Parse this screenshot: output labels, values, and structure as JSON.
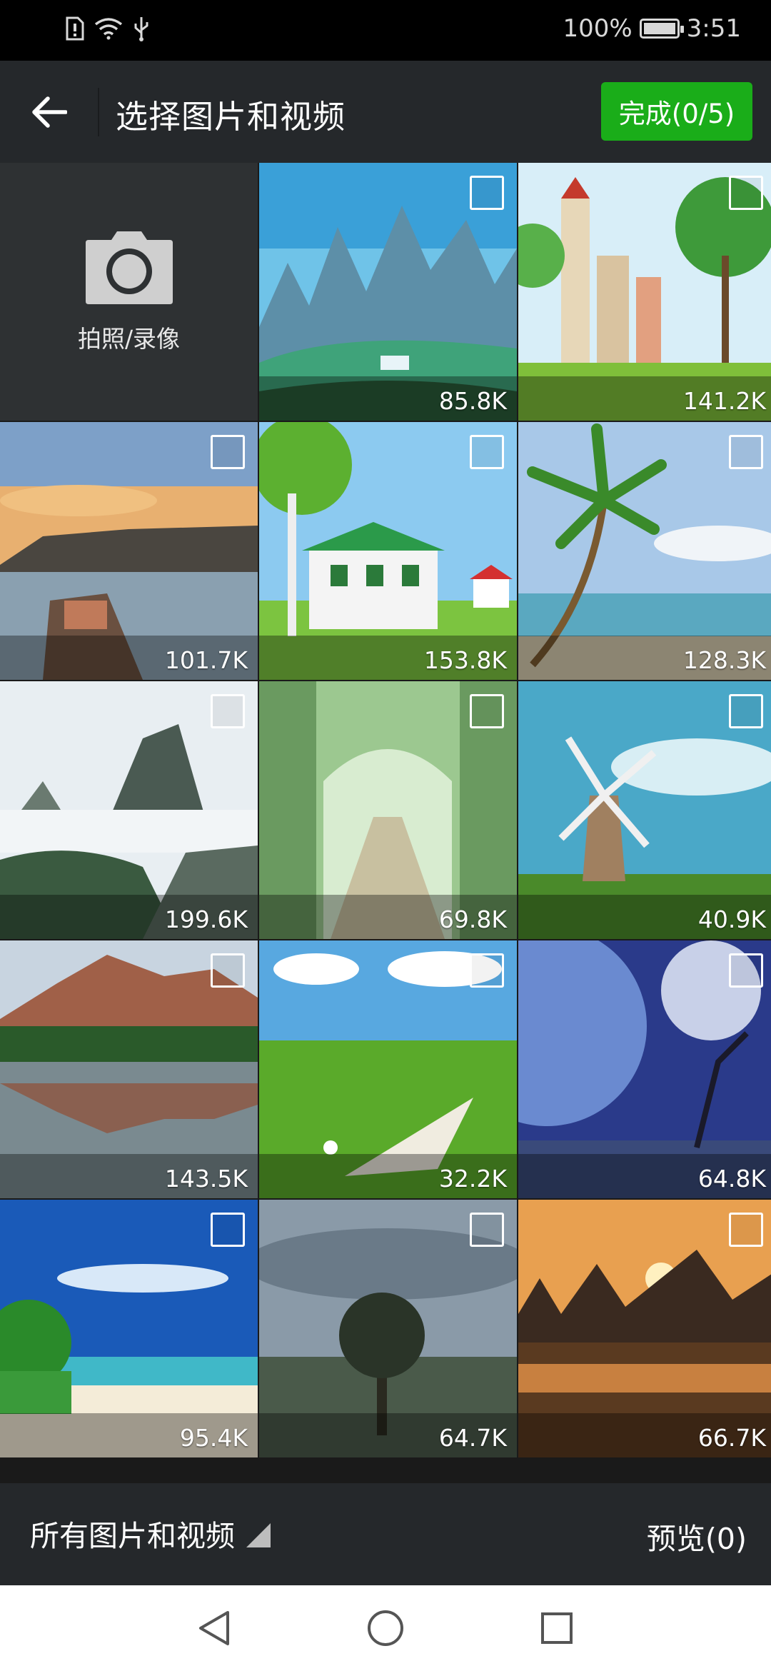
{
  "status_bar": {
    "battery": "100%",
    "time": "3:51"
  },
  "header": {
    "title": "选择图片和视频",
    "done_button": "完成(0/5)",
    "accent_color": "#1aad19"
  },
  "camera_tile": {
    "label": "拍照/录像"
  },
  "photos": [
    {
      "size": "85.8K"
    },
    {
      "size": "141.2K"
    },
    {
      "size": "101.7K"
    },
    {
      "size": "153.8K"
    },
    {
      "size": "128.3K"
    },
    {
      "size": "199.6K"
    },
    {
      "size": "69.8K"
    },
    {
      "size": "40.9K"
    },
    {
      "size": "143.5K"
    },
    {
      "size": "32.2K"
    },
    {
      "size": "64.8K"
    },
    {
      "size": "95.4K"
    },
    {
      "size": "64.7K"
    },
    {
      "size": "66.7K"
    }
  ],
  "bottom_bar": {
    "album_label": "所有图片和视频",
    "preview_button": "预览(0)"
  }
}
